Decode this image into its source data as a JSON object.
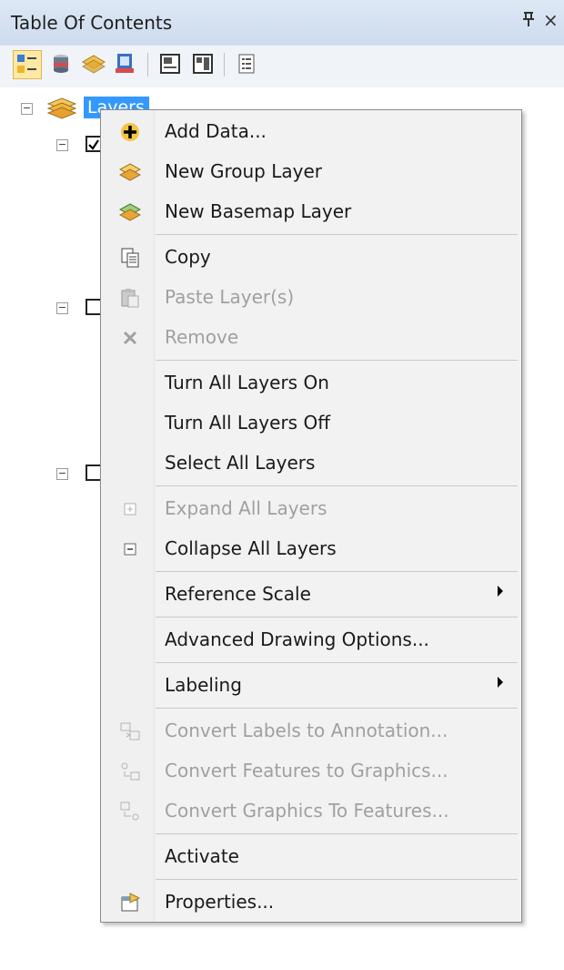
{
  "window": {
    "title": "Table Of Contents",
    "pin_glyph": "⊥",
    "close_glyph": "×"
  },
  "toolbar": {
    "buttons": [
      {
        "icon": "list-by-drawing-order-icon",
        "active": true
      },
      {
        "icon": "list-by-source-icon"
      },
      {
        "icon": "list-by-visibility-icon"
      },
      {
        "icon": "list-by-selection-icon"
      },
      {
        "icon": "options-icon"
      },
      {
        "icon": "layout-icon"
      },
      {
        "icon": "list-icon"
      }
    ]
  },
  "tree": {
    "root_label": "Layers"
  },
  "context_menu": {
    "items": [
      {
        "id": "add-data",
        "label": "Add Data...",
        "icon": "plus-icon",
        "enabled": true
      },
      {
        "id": "new-group-layer",
        "label": "New Group Layer",
        "icon": "group-layer-icon",
        "enabled": true
      },
      {
        "id": "new-basemap-layer",
        "label": "New Basemap Layer",
        "icon": "basemap-layer-icon",
        "enabled": true
      },
      {
        "id": "copy",
        "label": "Copy",
        "icon": "copy-icon",
        "enabled": true
      },
      {
        "id": "paste-layers",
        "label": "Paste Layer(s)",
        "icon": "paste-icon",
        "enabled": false
      },
      {
        "id": "remove",
        "label": "Remove",
        "icon": "remove-icon",
        "enabled": false
      },
      {
        "id": "turn-all-layers-on",
        "label": "Turn All Layers On",
        "enabled": true
      },
      {
        "id": "turn-all-layers-off",
        "label": "Turn All Layers Off",
        "enabled": true
      },
      {
        "id": "select-all-layers",
        "label": "Select All Layers",
        "enabled": true
      },
      {
        "id": "expand-all-layers",
        "label": "Expand All Layers",
        "icon": "expand-icon",
        "enabled": false
      },
      {
        "id": "collapse-all-layers",
        "label": "Collapse All Layers",
        "icon": "collapse-icon",
        "enabled": true
      },
      {
        "id": "reference-scale",
        "label": "Reference Scale",
        "enabled": true,
        "submenu": true
      },
      {
        "id": "advanced-drawing-options",
        "label": "Advanced Drawing Options...",
        "enabled": true
      },
      {
        "id": "labeling",
        "label": "Labeling",
        "enabled": true,
        "submenu": true
      },
      {
        "id": "convert-labels-to-annotation",
        "label": "Convert Labels to Annotation...",
        "icon": "convert-labels-icon",
        "enabled": false
      },
      {
        "id": "convert-features-to-graphics",
        "label": "Convert Features to Graphics...",
        "icon": "convert-features-icon",
        "enabled": false
      },
      {
        "id": "convert-graphics-to-features",
        "label": "Convert Graphics To Features...",
        "icon": "convert-graphics-icon",
        "enabled": false
      },
      {
        "id": "activate",
        "label": "Activate",
        "enabled": true
      },
      {
        "id": "properties",
        "label": "Properties...",
        "icon": "properties-icon",
        "enabled": true
      }
    ]
  }
}
